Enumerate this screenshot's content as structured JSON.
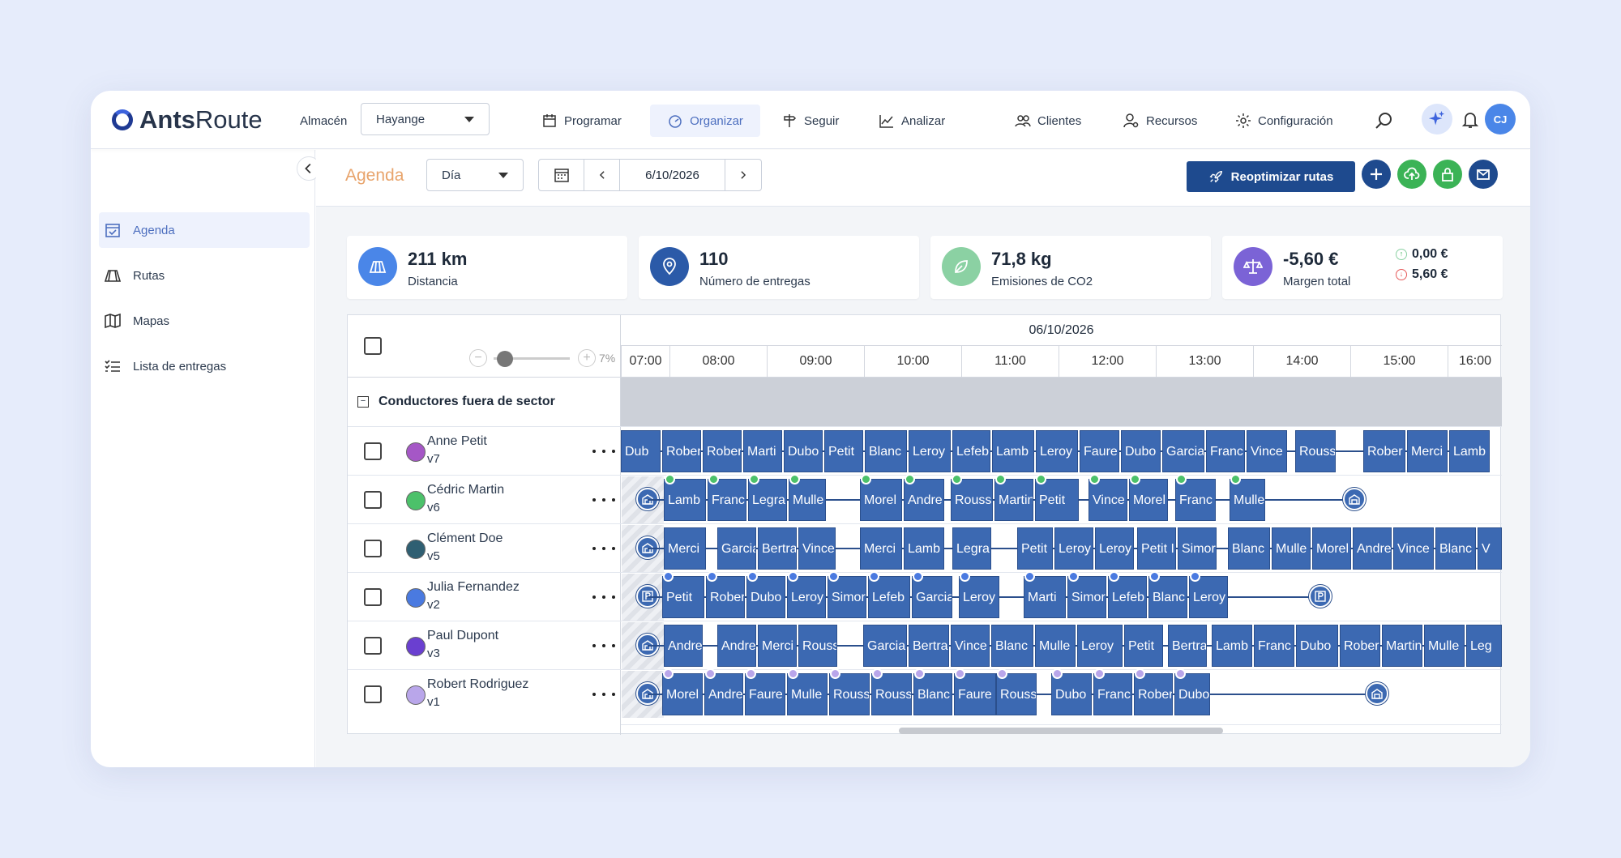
{
  "brand": {
    "name_bold": "Ants",
    "name_rest": "Route"
  },
  "header": {
    "warehouse_label": "Almacén",
    "warehouse_value": "Hayange",
    "nav": [
      {
        "label": "Programar",
        "icon": "calendar-icon"
      },
      {
        "label": "Organizar",
        "icon": "gauge-icon",
        "active": true
      },
      {
        "label": "Seguir",
        "icon": "signpost-icon"
      },
      {
        "label": "Analizar",
        "icon": "chart-icon"
      },
      {
        "label": "Clientes",
        "icon": "users-icon"
      },
      {
        "label": "Recursos",
        "icon": "user-gear-icon"
      },
      {
        "label": "Configuración",
        "icon": "gear-icon"
      }
    ],
    "avatar": "CJ"
  },
  "sidebar": {
    "items": [
      {
        "label": "Agenda",
        "icon": "calendar-check-icon",
        "active": true
      },
      {
        "label": "Rutas",
        "icon": "map-fold-icon"
      },
      {
        "label": "Mapas",
        "icon": "map-pin-icon"
      },
      {
        "label": "Lista de entregas",
        "icon": "list-icon"
      }
    ]
  },
  "toolbar": {
    "title": "Agenda",
    "view": "Día",
    "date": "6/10/2026",
    "reoptimize": "Reoptimizar rutas"
  },
  "kpis": [
    {
      "value": "211 km",
      "label": "Distancia",
      "color": "#4a86e8"
    },
    {
      "value": "110",
      "label": "Número de entregas",
      "color": "#2b5aa8"
    },
    {
      "value": "71,8 kg",
      "label": "Emisiones de CO2",
      "color": "#8bd1a3"
    },
    {
      "value": "-5,60 €",
      "label": "Margen total",
      "color": "#7b63d6",
      "up": "0,00 €",
      "down": "5,60 €"
    }
  ],
  "schedule": {
    "date": "06/10/2026",
    "zoom": "7%",
    "hours": [
      "07:00",
      "08:00",
      "09:00",
      "10:00",
      "11:00",
      "12:00",
      "13:00",
      "14:00",
      "15:00",
      "16:00"
    ],
    "group": "Conductores fuera de sector",
    "drivers": [
      {
        "name": "Anne Petit",
        "vehicle": "v7",
        "color": "#a557c6"
      },
      {
        "name": "Cédric Martin",
        "vehicle": "v6",
        "color": "#4cc16a"
      },
      {
        "name": "Clément Doe",
        "vehicle": "v5",
        "color": "#2f5f72"
      },
      {
        "name": "Julia Fernandez",
        "vehicle": "v2",
        "color": "#4a7ae0"
      },
      {
        "name": "Paul Dupont",
        "vehicle": "v3",
        "color": "#6a3fd0"
      },
      {
        "name": "Robert Rodriguez",
        "vehicle": "v1",
        "color": "#b9a6ea"
      }
    ],
    "rows": [
      [
        "Dub",
        "Rober",
        "Rober",
        "Marti",
        "Dubo",
        "Petit",
        "Blanc",
        "Leroy",
        "Lefeb",
        "Lamb",
        "Leroy",
        "Faure",
        "Dubo",
        "Garcia",
        "Franc",
        "Vince",
        "Rouss",
        "Rober",
        "Merci",
        "Lamb"
      ],
      [
        "Lamb",
        "Franc",
        "Legra",
        "Mulle",
        "Morel",
        "Andre",
        "Rouss",
        "Martin",
        "Petit",
        "Vince",
        "Morel",
        "Franc",
        "Mulle"
      ],
      [
        "Merci",
        "Garcia",
        "Bertra",
        "Vince",
        "Merci",
        "Lamb",
        "Legra",
        "Petit",
        "Leroy",
        "Leroy",
        "Petit I",
        "Simor",
        "Blanc",
        "Mulle",
        "Morel",
        "Andre",
        "Vince",
        "Blanc",
        "V"
      ],
      [
        "Petit",
        "Rober",
        "Dubo",
        "Leroy",
        "Simor",
        "Lefeb",
        "Garcia",
        "Leroy",
        "Marti",
        "Simor",
        "Lefeb",
        "Blanc",
        "Leroy"
      ],
      [
        "Andre",
        "Andre",
        "Merci",
        "Rouss",
        "Garcia",
        "Bertra",
        "Vince",
        "Blanc",
        "Mulle",
        "Leroy",
        "Petit",
        "Bertra",
        "Lamb",
        "Franc",
        "Dubo",
        "Rober",
        "Martin",
        "Mulle",
        "Leg"
      ],
      [
        "Morel",
        "Andre",
        "Faure",
        "Mulle",
        "Rouss",
        "Rouss",
        "Blanc",
        "Faure",
        "Rouss",
        "Dubo",
        "Franc",
        "Rober",
        "Dubo"
      ]
    ]
  }
}
